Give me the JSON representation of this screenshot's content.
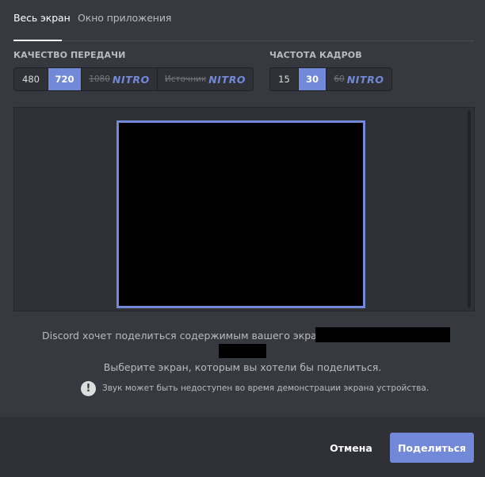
{
  "tabs": {
    "full_screen": "Весь экран",
    "app_window": "Окно приложения"
  },
  "quality": {
    "label": "КАЧЕСТВО ПЕРЕДАЧИ",
    "options": [
      "480",
      "720",
      "1080",
      "Источник"
    ],
    "selected": "720",
    "nitro_badge": "NITRO"
  },
  "framerate": {
    "label": "ЧАСТОТА КАДРОВ",
    "options": [
      "15",
      "30",
      "60"
    ],
    "selected": "30",
    "nitro_badge": "NITRO"
  },
  "message": {
    "line1": "Discord хочет поделиться содержимым вашего экрана с",
    "line2": "Выберите экран, которым вы хотели бы поделиться.",
    "warning": "Звук может быть недоступен во время демонстрации экрана устройства.",
    "warning_icon": "exclamation-icon"
  },
  "footer": {
    "cancel_label": "Отмена",
    "share_label": "Поделиться"
  },
  "colors": {
    "accent": "#7289da",
    "background": "#36393f",
    "footer_background": "#2f3136"
  }
}
